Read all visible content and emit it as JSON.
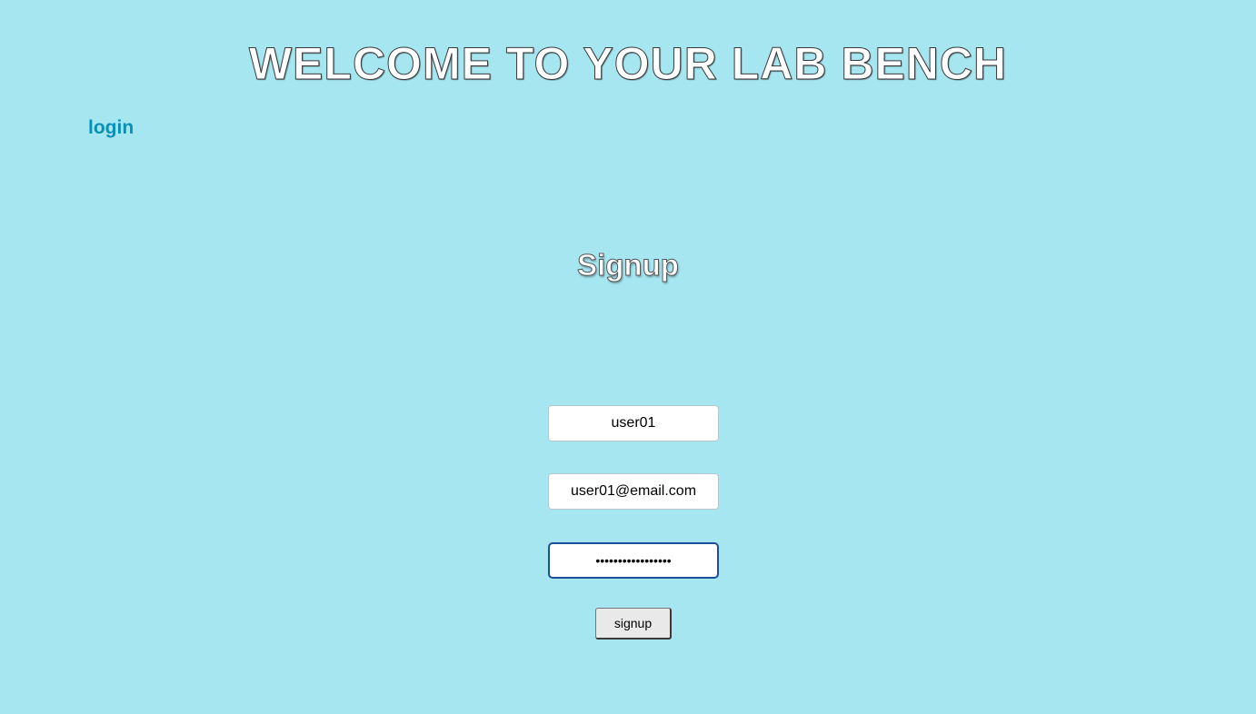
{
  "header": {
    "title": "WELCOME TO YOUR LAB BENCH"
  },
  "nav": {
    "login_label": "login"
  },
  "form": {
    "title": "Signup",
    "username_value": "user01",
    "email_value": "user01@email.com",
    "password_value": "•••••••••••••••••",
    "submit_label": "signup"
  },
  "colors": {
    "background": "#a6e6f0",
    "link": "#0a8fb5",
    "focus_border": "#1c4e9c"
  }
}
